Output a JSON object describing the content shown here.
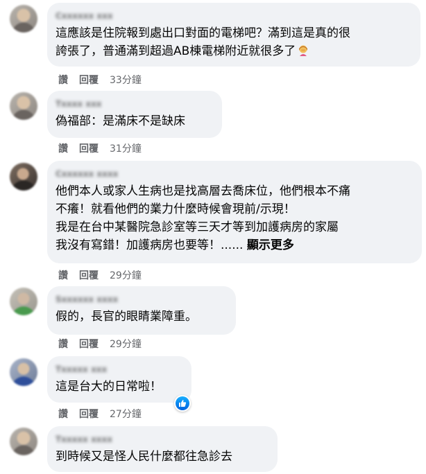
{
  "actions": {
    "like": "讚",
    "reply": "回覆"
  },
  "comments": [
    {
      "author": "Cxxxxxx xxx",
      "lines": [
        "這應該是住院報到處出口對面的電梯吧？滿到這是真的很",
        "誇張了，普通滿到超過AB棟電梯附近就很多了"
      ],
      "time": "33分鐘",
      "emoji": "woman-facepalming-icon"
    },
    {
      "author": "Txxxx xxx",
      "lines": [
        "偽福部：是滿床不是缺床"
      ],
      "time": "31分鐘"
    },
    {
      "author": "Cxxxxxx xxxx",
      "lines": [
        "他們本人或家人生病也是找高層去喬床位，他們根本不痛",
        "不癢！就看他們的業力什麼時候會現前/示現！",
        "我是在台中某醫院急診室等三天才等到加護病房的家屬",
        "我沒有寫錯！加護病房也要等！......"
      ],
      "see_more": "顯示更多",
      "time": "29分鐘"
    },
    {
      "author": "Sxxxxxx xxxx",
      "lines": [
        "假的，長官的眼睛業障重。"
      ],
      "time": "29分鐘"
    },
    {
      "author": "Txxxxx xxx",
      "lines": [
        "這是台大的日常啦！"
      ],
      "time": "27分鐘",
      "reaction": "like-icon"
    },
    {
      "author": "Txxxxx xxxx",
      "lines": [
        "到時候又是怪人民什麼都往急診去"
      ]
    }
  ]
}
